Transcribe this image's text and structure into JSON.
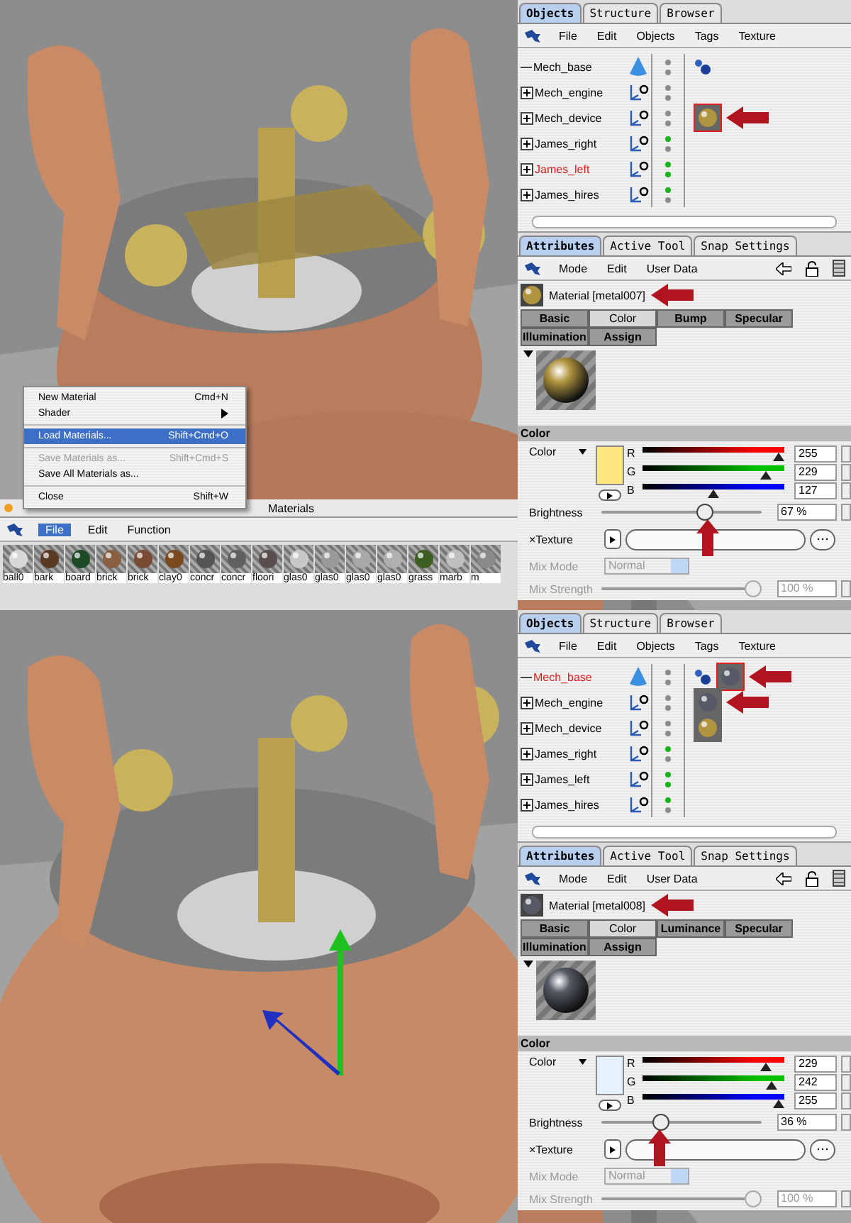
{
  "screens": [
    {
      "context_menu": {
        "items": [
          {
            "kind": "item",
            "label": "New Material",
            "shortcut": "Cmd+N",
            "selected": false,
            "disabled": false
          },
          {
            "kind": "submenu",
            "label": "Shader",
            "selected": false,
            "disabled": false
          },
          {
            "kind": "separator"
          },
          {
            "kind": "item",
            "label": "Load Materials...",
            "shortcut": "Shift+Cmd+O",
            "selected": true,
            "disabled": false
          },
          {
            "kind": "separator"
          },
          {
            "kind": "item",
            "label": "Save Materials as...",
            "shortcut": "Shift+Cmd+S",
            "selected": false,
            "disabled": true
          },
          {
            "kind": "item",
            "label": "Save All Materials as...",
            "selected": false,
            "disabled": false
          },
          {
            "kind": "separator"
          },
          {
            "kind": "item",
            "label": "Close",
            "shortcut": "Shift+W",
            "selected": false,
            "disabled": false
          }
        ]
      },
      "material_manager": {
        "title": "Materials",
        "menu": [
          {
            "label": "File",
            "selected": true
          },
          {
            "label": "Edit",
            "selected": false
          },
          {
            "label": "Function",
            "selected": false
          }
        ],
        "materials": [
          {
            "name": "ball0",
            "color": "#d8d8d8"
          },
          {
            "name": "bark",
            "color": "#5a3a22"
          },
          {
            "name": "board",
            "color": "#1f4a26"
          },
          {
            "name": "brick",
            "color": "#8a6040"
          },
          {
            "name": "brick",
            "color": "#7a4a34"
          },
          {
            "name": "clay0",
            "color": "#7a4a1e"
          },
          {
            "name": "concr",
            "color": "#555555"
          },
          {
            "name": "concr",
            "color": "#606060"
          },
          {
            "name": "floori",
            "color": "#5a4d4d"
          },
          {
            "name": "glas0",
            "color": "#c8c8c8"
          },
          {
            "name": "glas0",
            "color": "#9a9a9a"
          },
          {
            "name": "glas0",
            "color": "#a8a8a8"
          },
          {
            "name": "glas0",
            "color": "#b0b0b0"
          },
          {
            "name": "grass",
            "color": "#3d5e22"
          },
          {
            "name": "marb",
            "color": "#bfbfbf"
          },
          {
            "name": "m",
            "color": "#8a8a8a"
          }
        ]
      },
      "objects_manager": {
        "tabs": [
          {
            "label": "Objects",
            "selected": true
          },
          {
            "label": "Structure",
            "selected": false
          },
          {
            "label": "Browser",
            "selected": false
          }
        ],
        "menu": [
          "File",
          "Edit",
          "Objects",
          "Tags",
          "Texture"
        ],
        "objects": [
          {
            "name": "Mech_base",
            "kind": "polygon",
            "expandable": false,
            "selected": false,
            "dots": [
              {
                "color": "#8c8c8c"
              },
              {
                "color": "#8c8c8c"
              }
            ],
            "tags": [
              {
                "kind": "hierarchy"
              }
            ]
          },
          {
            "name": "Mech_engine",
            "kind": "null",
            "expandable": true,
            "selected": false,
            "dots": [
              {
                "color": "#8c8c8c"
              },
              {
                "color": "#8c8c8c"
              }
            ]
          },
          {
            "name": "Mech_device",
            "kind": "null",
            "expandable": true,
            "selected": false,
            "dots": [
              {
                "color": "#8c8c8c"
              },
              {
                "color": "#8c8c8c"
              }
            ],
            "tags": [
              {
                "kind": "material",
                "color": "#b09440",
                "selected": true,
                "annotated": true
              }
            ]
          },
          {
            "name": "James_right",
            "kind": "null",
            "expandable": true,
            "selected": false,
            "dots": [
              {
                "color": "#19b219"
              },
              {
                "color": "#8c8c8c"
              }
            ]
          },
          {
            "name": "James_left",
            "kind": "null",
            "expandable": true,
            "selected": true,
            "dots": [
              {
                "color": "#19b219"
              },
              {
                "color": "#19b219"
              }
            ]
          },
          {
            "name": "James_hires",
            "kind": "null",
            "expandable": true,
            "selected": false,
            "dots": [
              {
                "color": "#19b219"
              },
              {
                "color": "#8c8c8c"
              }
            ]
          }
        ]
      },
      "attributes": {
        "tabs": [
          {
            "label": "Attributes",
            "selected": true
          },
          {
            "label": "Active Tool",
            "selected": false
          },
          {
            "label": "Snap Settings",
            "selected": false
          }
        ],
        "menu": [
          "Mode",
          "Edit",
          "User Data"
        ],
        "material": {
          "name": "Material [metal007]",
          "color": "#b09440",
          "annotated": true
        },
        "subtabs": [
          {
            "label": "Basic",
            "selected": false
          },
          {
            "label": "Color",
            "selected": true
          },
          {
            "label": "Bump",
            "selected": false
          },
          {
            "label": "Specular",
            "selected": false
          },
          {
            "label": "Illumination",
            "selected": false
          },
          {
            "label": "Assign",
            "selected": false
          }
        ],
        "section": "Color",
        "color_label": "Color",
        "swatch": {
          "color": "#ffe57f"
        },
        "channels": [
          {
            "name": "R",
            "color": "#ff0000",
            "level": 1.0,
            "reading": "255"
          },
          {
            "name": "G",
            "color": "#00c000",
            "level": 0.9,
            "reading": "229"
          },
          {
            "name": "B",
            "color": "#0000ff",
            "level": 0.5,
            "reading": "127"
          }
        ],
        "brightness": {
          "label": "Brightness",
          "level": 0.67,
          "reading": "67 %",
          "annotated": true
        },
        "texture": {
          "label": "×Texture"
        },
        "mix_mode": {
          "label": "Mix Mode",
          "value": "Normal"
        },
        "mix_strength": {
          "label": "Mix Strength",
          "level": 1.0,
          "reading": "100 %"
        }
      }
    },
    {
      "objects_manager": {
        "tabs": [
          {
            "label": "Objects",
            "selected": true
          },
          {
            "label": "Structure",
            "selected": false
          },
          {
            "label": "Browser",
            "selected": false
          }
        ],
        "menu": [
          "File",
          "Edit",
          "Objects",
          "Tags",
          "Texture"
        ],
        "objects": [
          {
            "name": "Mech_base",
            "kind": "polygon",
            "expandable": false,
            "selected": true,
            "dots": [
              {
                "color": "#8c8c8c"
              },
              {
                "color": "#8c8c8c"
              }
            ],
            "tags": [
              {
                "kind": "hierarchy"
              },
              {
                "kind": "material",
                "color": "#555a66",
                "selected": true,
                "annotated": true
              }
            ]
          },
          {
            "name": "Mech_engine",
            "kind": "null",
            "expandable": true,
            "selected": false,
            "dots": [
              {
                "color": "#8c8c8c"
              },
              {
                "color": "#8c8c8c"
              }
            ],
            "tags": [
              {
                "kind": "material",
                "color": "#555a66",
                "selected": false,
                "annotated": true
              }
            ]
          },
          {
            "name": "Mech_device",
            "kind": "null",
            "expandable": true,
            "selected": false,
            "dots": [
              {
                "color": "#8c8c8c"
              },
              {
                "color": "#8c8c8c"
              }
            ],
            "tags": [
              {
                "kind": "material",
                "color": "#b09440",
                "selected": false
              }
            ]
          },
          {
            "name": "James_right",
            "kind": "null",
            "expandable": true,
            "selected": false,
            "dots": [
              {
                "color": "#19b219"
              },
              {
                "color": "#8c8c8c"
              }
            ]
          },
          {
            "name": "James_left",
            "kind": "null",
            "expandable": true,
            "selected": false,
            "dots": [
              {
                "color": "#19b219"
              },
              {
                "color": "#19b219"
              }
            ]
          },
          {
            "name": "James_hires",
            "kind": "null",
            "expandable": true,
            "selected": false,
            "dots": [
              {
                "color": "#19b219"
              },
              {
                "color": "#8c8c8c"
              }
            ]
          }
        ]
      },
      "attributes": {
        "tabs": [
          {
            "label": "Attributes",
            "selected": true
          },
          {
            "label": "Active Tool",
            "selected": false
          },
          {
            "label": "Snap Settings",
            "selected": false
          }
        ],
        "menu": [
          "Mode",
          "Edit",
          "User Data"
        ],
        "material": {
          "name": "Material [metal008]",
          "color": "#555a66",
          "annotated": true
        },
        "subtabs": [
          {
            "label": "Basic",
            "selected": false
          },
          {
            "label": "Color",
            "selected": true
          },
          {
            "label": "Luminance",
            "selected": false
          },
          {
            "label": "Specular",
            "selected": false
          },
          {
            "label": "Illumination",
            "selected": false
          },
          {
            "label": "Assign",
            "selected": false
          }
        ],
        "section": "Color",
        "color_label": "Color",
        "swatch": {
          "color": "#e5f2ff"
        },
        "channels": [
          {
            "name": "R",
            "color": "#ff0000",
            "level": 0.9,
            "reading": "229"
          },
          {
            "name": "G",
            "color": "#00c000",
            "level": 0.95,
            "reading": "242"
          },
          {
            "name": "B",
            "color": "#0000ff",
            "level": 1.0,
            "reading": "255"
          }
        ],
        "brightness": {
          "label": "Brightness",
          "level": 0.36,
          "reading": "36 %",
          "annotated": true
        },
        "texture": {
          "label": "×Texture"
        },
        "mix_mode": {
          "label": "Mix Mode",
          "value": "Normal"
        },
        "mix_strength": {
          "label": "Mix Strength",
          "level": 1.0,
          "reading": "100 %"
        }
      }
    }
  ]
}
